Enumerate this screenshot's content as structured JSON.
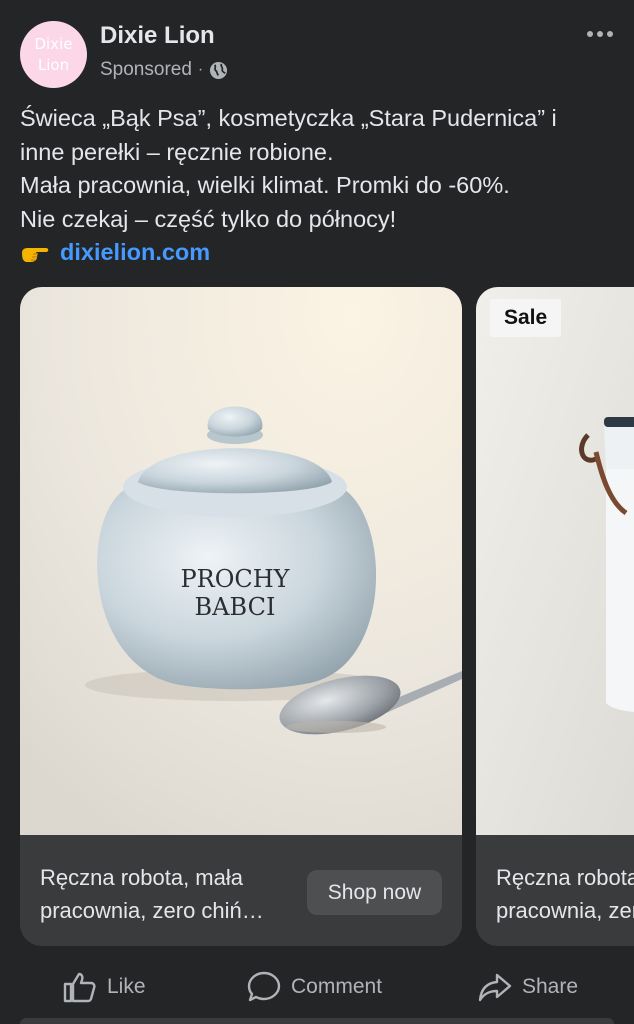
{
  "post": {
    "page_name": "Dixie Lion",
    "avatar_text": [
      "Dixie",
      "Lion"
    ],
    "sponsored": "Sponsored",
    "separator": "·",
    "text_lines": [
      "Świeca „Bąk Psa”, kosmetyczka „Stara Pudernica” i",
      "inne perełki – ręcznie robione.",
      "Mała pracownia, wielki klimat. Promki do -60%.",
      "Nie czekaj – część tylko do północy!"
    ],
    "link": "dixielion.com"
  },
  "carousel": {
    "cards": [
      {
        "image_text": [
          "PROCHY",
          "BABCI"
        ],
        "title_lines": [
          "Ręczna robota, mała",
          "pracownia, zero chiń…"
        ],
        "cta": "Shop now"
      },
      {
        "badge": "Sale",
        "title_lines": [
          "Ręczna robota, mała",
          "pracownia, zero chiń…"
        ]
      }
    ]
  },
  "actions": {
    "like": "Like",
    "comment": "Comment",
    "share": "Share"
  },
  "icons": {
    "more": "more-horizontal-icon",
    "audience": "globe-icon",
    "pointer": "pointing-hand-emoji-icon",
    "like": "thumbs-up-icon",
    "comment": "comment-bubble-icon",
    "share": "share-arrow-icon"
  },
  "colors": {
    "background": "#242526",
    "link": "#4599ff",
    "card": "#3a3b3c",
    "avatar": "#fbd7e8"
  }
}
